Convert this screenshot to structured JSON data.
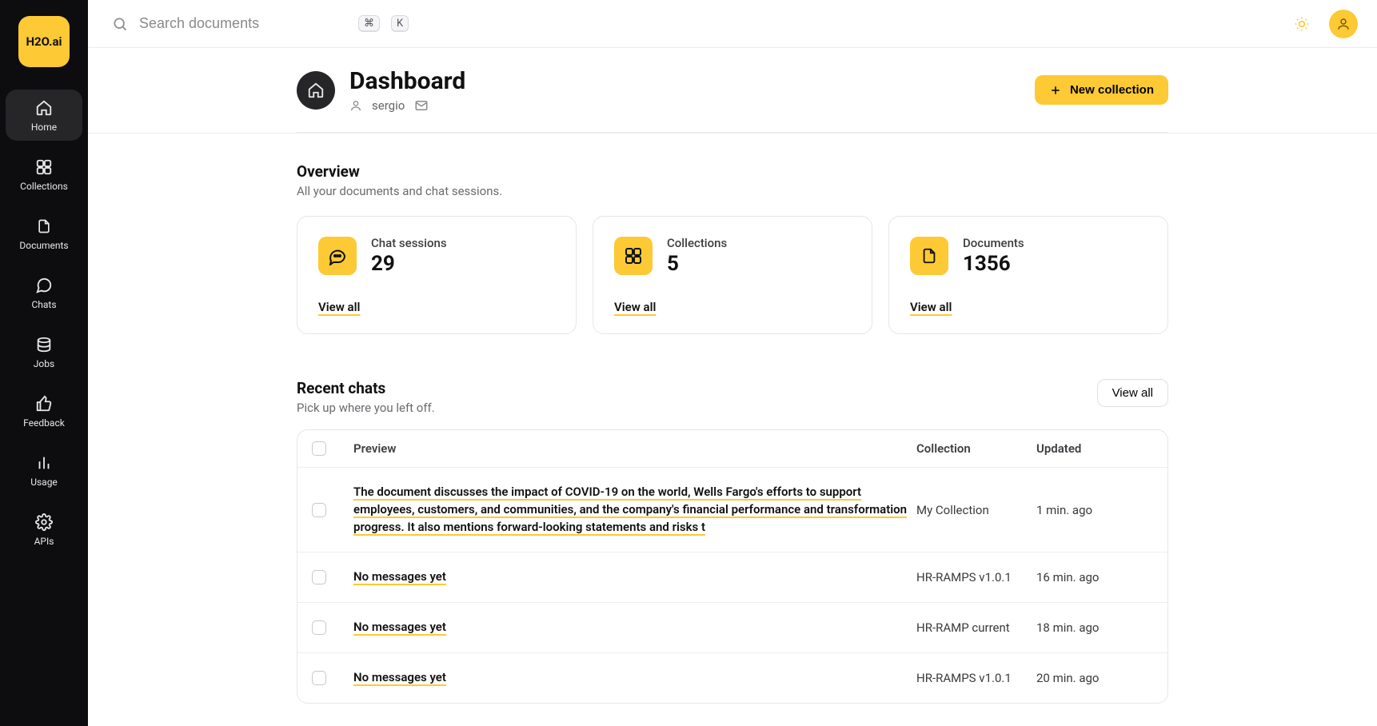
{
  "brand": {
    "logo_text": "H2O.ai"
  },
  "sidebar": {
    "items": [
      {
        "label": "Home"
      },
      {
        "label": "Collections"
      },
      {
        "label": "Documents"
      },
      {
        "label": "Chats"
      },
      {
        "label": "Jobs"
      },
      {
        "label": "Feedback"
      },
      {
        "label": "Usage"
      },
      {
        "label": "APIs"
      }
    ]
  },
  "search": {
    "placeholder": "Search documents",
    "shortcut_mod": "⌘",
    "shortcut_key": "K"
  },
  "header": {
    "title": "Dashboard",
    "username": "sergio",
    "new_collection_label": "New collection"
  },
  "overview": {
    "title": "Overview",
    "subtitle": "All your documents and chat sessions.",
    "view_all": "View all",
    "stats": [
      {
        "label": "Chat sessions",
        "value": "29"
      },
      {
        "label": "Collections",
        "value": "5"
      },
      {
        "label": "Documents",
        "value": "1356"
      }
    ]
  },
  "recent": {
    "title": "Recent chats",
    "subtitle": "Pick up where you left off.",
    "view_all_btn": "View all",
    "columns": {
      "preview": "Preview",
      "collection": "Collection",
      "updated": "Updated"
    },
    "rows": [
      {
        "preview": "The document discusses the impact of COVID-19 on the world, Wells Fargo's efforts to support employees, customers, and communities, and the company's financial performance and transformation progress. It also mentions forward-looking statements and risks t",
        "collection": "My Collection",
        "updated": "1 min. ago"
      },
      {
        "preview": "No messages yet",
        "collection": "HR-RAMPS v1.0.1",
        "updated": "16 min. ago"
      },
      {
        "preview": "No messages yet",
        "collection": "HR-RAMP current",
        "updated": "18 min. ago"
      },
      {
        "preview": "No messages yet",
        "collection": "HR-RAMPS v1.0.1",
        "updated": "20 min. ago"
      }
    ]
  }
}
